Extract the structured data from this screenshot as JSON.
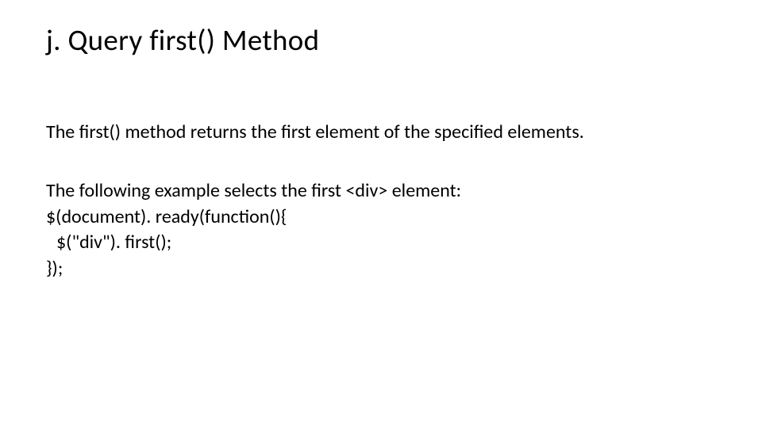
{
  "title": "j. Query first() Method",
  "paragraph1": "The first() method returns the first element of the specified elements.",
  "paragraph2": "The following example selects the first <div> element:",
  "code": {
    "line1": "$(document). ready(function(){",
    "line2": "$(\"div\"). first();",
    "line3": "});"
  }
}
